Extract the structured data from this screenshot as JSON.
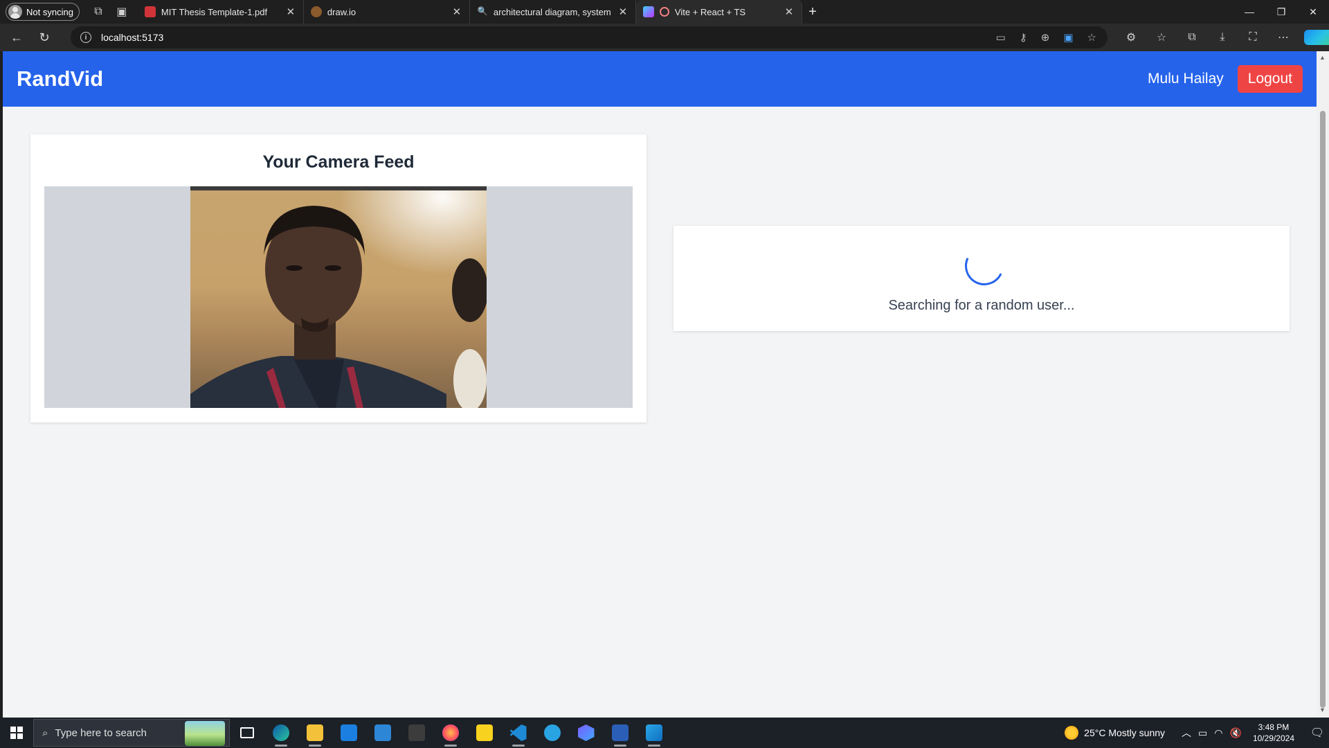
{
  "browser": {
    "profile_label": "Not syncing",
    "tabs": [
      {
        "title": "MIT Thesis Template-1.pdf",
        "favicon_color": "#d13438"
      },
      {
        "title": "draw.io",
        "favicon_color": "#f08705"
      },
      {
        "title": "architectural diagram, system arc",
        "favicon_color": "#1d8fe1"
      },
      {
        "title": "Vite + React + TS",
        "favicon_color": "#bd34fe"
      }
    ],
    "close_glyph": "✕",
    "new_tab_glyph": "+",
    "address": "localhost:5173",
    "win_controls": {
      "minimize": "—",
      "restore": "❐",
      "close": "✕"
    }
  },
  "app": {
    "brand": "RandVid",
    "user_name": "Mulu Hailay",
    "logout_label": "Logout",
    "camera_title": "Your Camera Feed",
    "search_status": "Searching for a random user...",
    "accent_color": "#2563eb",
    "logout_color": "#ef4444"
  },
  "taskbar": {
    "search_placeholder": "Type here to search",
    "weather": "25°C  Mostly sunny",
    "time": "3:48 PM",
    "date": "10/29/2024",
    "apps": [
      "task-view",
      "edge",
      "file-explorer",
      "microsoft-store",
      "mail",
      "camera",
      "firefox",
      "notes",
      "vs-code",
      "telegram",
      "copilot-app",
      "word",
      "photos"
    ]
  }
}
